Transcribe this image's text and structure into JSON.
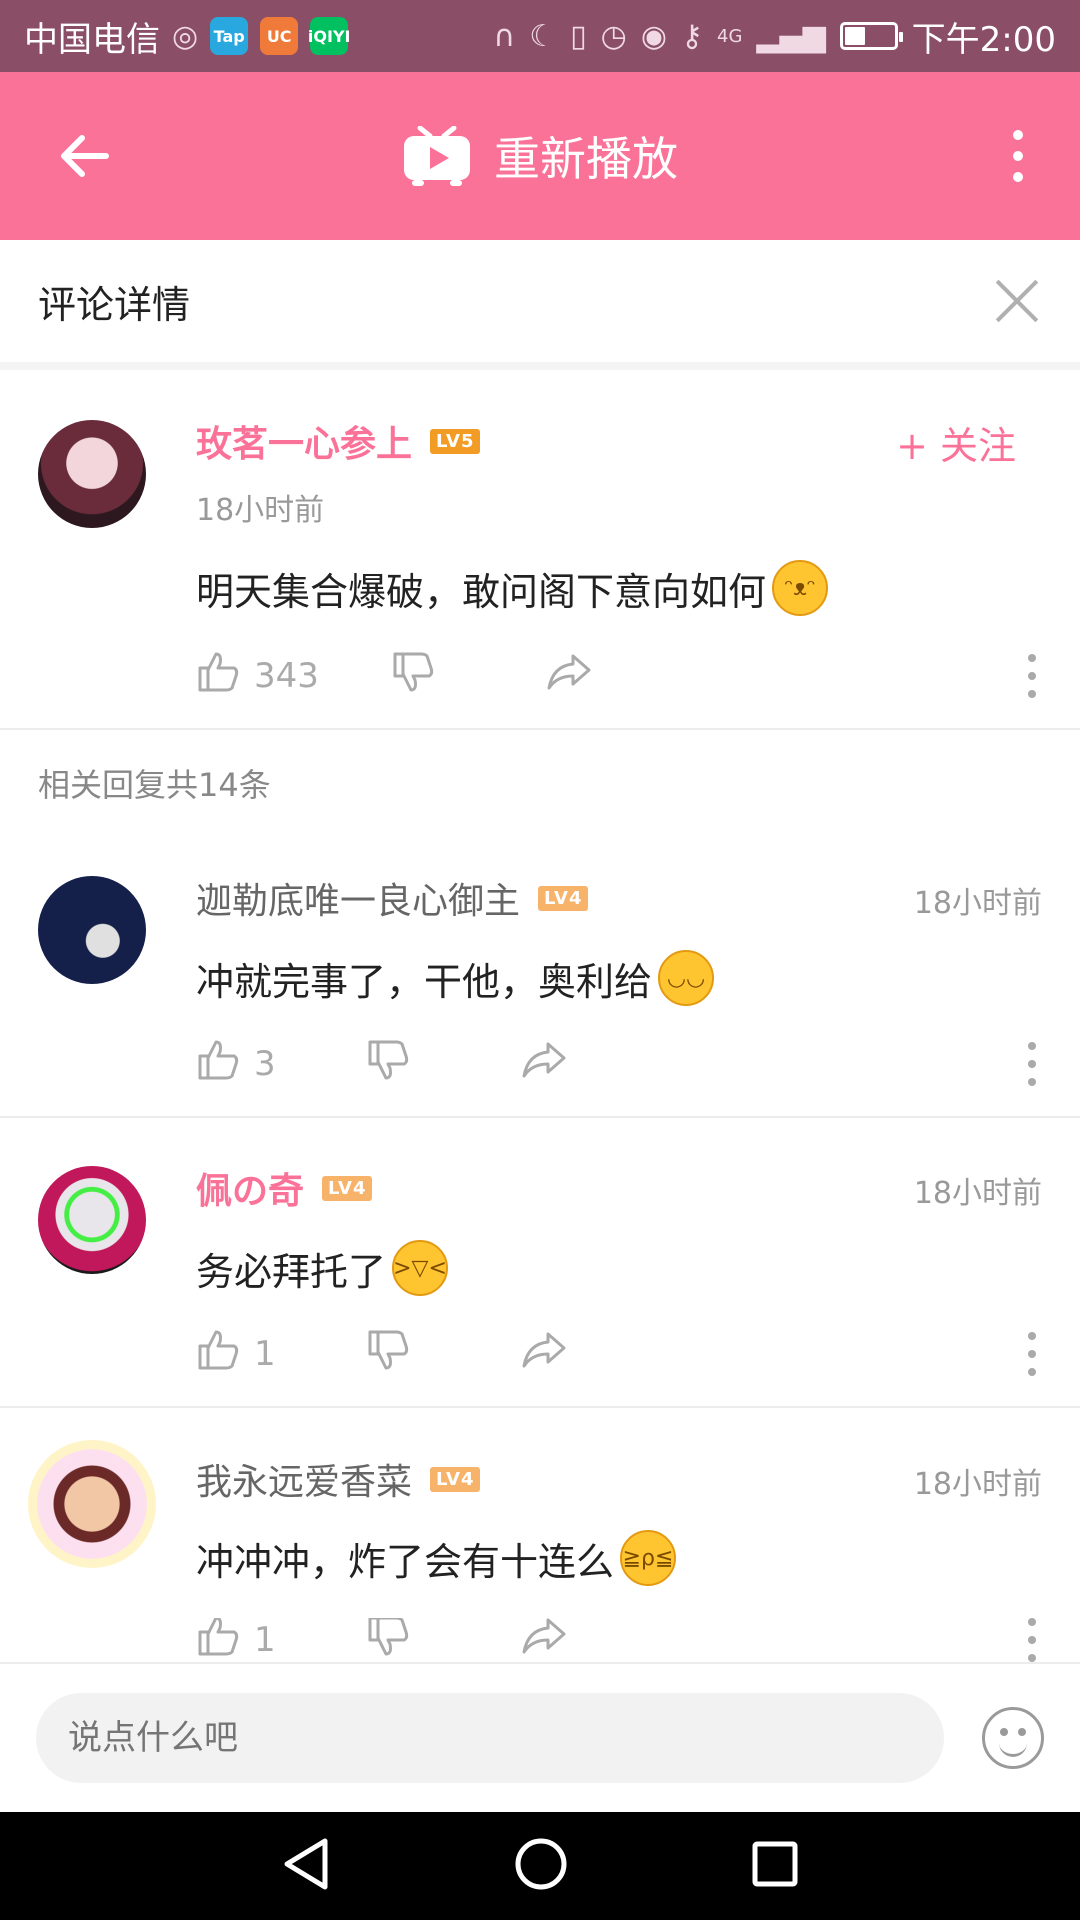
{
  "status_bar": {
    "carrier": "中国电信",
    "app_icons": [
      "Tap",
      "UC",
      "iQIYI"
    ],
    "network": "4G",
    "time": "下午2:00"
  },
  "top_bar": {
    "replay_label": "重新播放",
    "back_icon": "back-arrow-icon",
    "more_icon": "more-vertical-icon",
    "tv_icon": "tv-play-icon",
    "background": "#fb7299"
  },
  "detail_header": {
    "title": "评论详情"
  },
  "main_comment": {
    "username": "玫茗一心参上",
    "level": "LV5",
    "time": "18小时前",
    "follow_label": "+ 关注",
    "text": "明天集合爆破，敢问阁下意向如何",
    "likes": "343"
  },
  "reply_count": "相关回复共14条",
  "replies": [
    {
      "username": "迦勒底唯一良心御主",
      "level": "LV4",
      "time": "18小时前",
      "text": "冲就完事了，干他，奥利给",
      "likes": "3",
      "name_color": "#666666"
    },
    {
      "username": "佩の奇",
      "level": "LV4",
      "time": "18小时前",
      "text": "务必拜托了",
      "likes": "1",
      "name_color": "#fb7299"
    },
    {
      "username": "我永远爱香菜",
      "level": "LV4",
      "time": "18小时前",
      "text": "冲冲冲，炸了会有十连么",
      "likes": "1",
      "name_color": "#666666"
    }
  ],
  "input": {
    "placeholder": "说点什么吧"
  }
}
